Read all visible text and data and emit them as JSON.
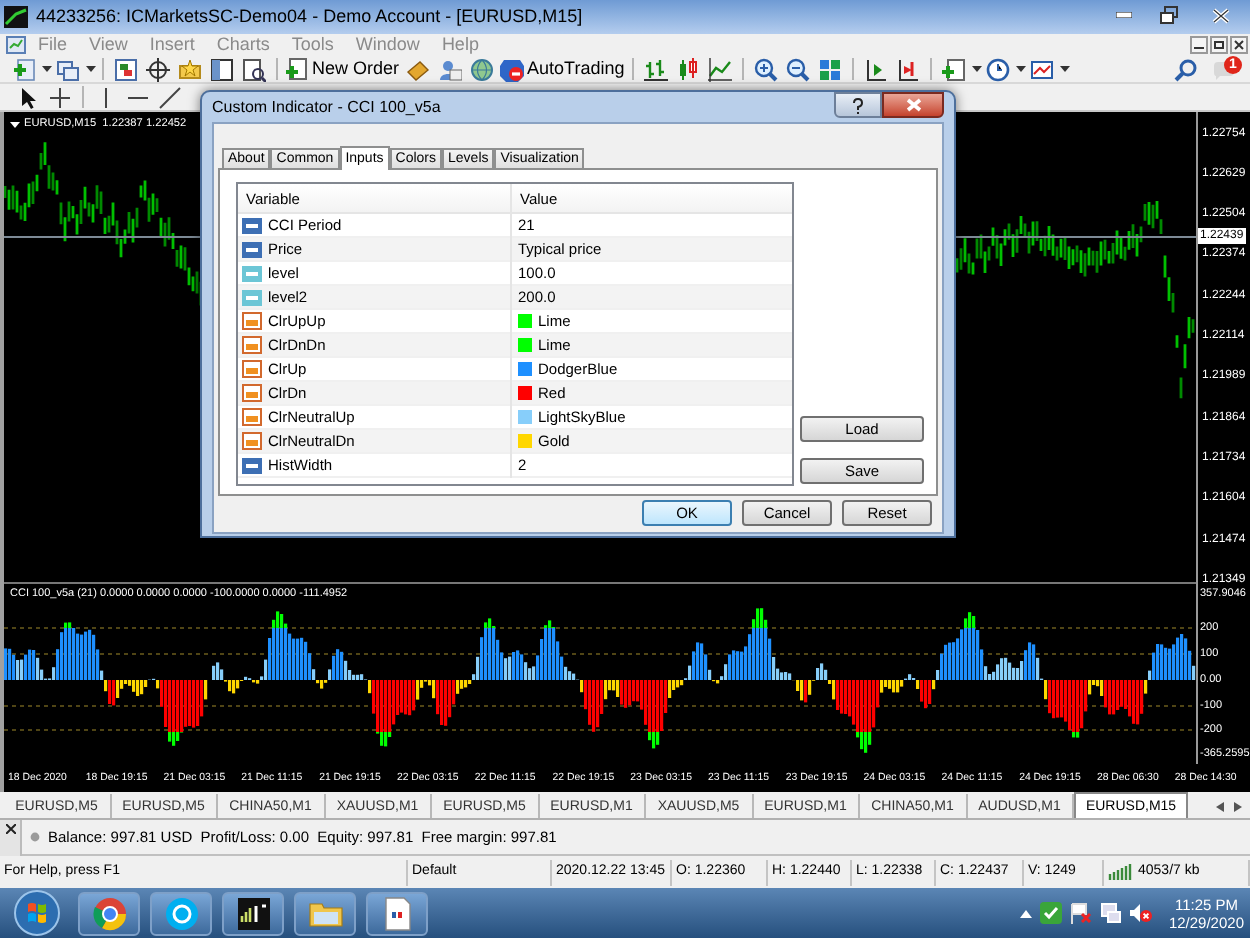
{
  "window": {
    "title": "44233256: ICMarketsSC-Demo04 - Demo Account - [EURUSD,M15]"
  },
  "menu": [
    "File",
    "View",
    "Insert",
    "Charts",
    "Tools",
    "Window",
    "Help"
  ],
  "toolbar": {
    "new_order": "New Order",
    "autotrading": "AutoTrading",
    "notifications": "1"
  },
  "chart": {
    "caption": "EURUSD,M15  1.22387 1.22452",
    "price_axis": [
      "1.22754",
      "1.22629",
      "1.22504",
      "1.22374",
      "1.22244",
      "1.22114",
      "1.21989",
      "1.21864",
      "1.21734",
      "1.21604",
      "1.21474",
      "1.21349"
    ],
    "current_price": "1.22439",
    "indicator_caption": "CCI 100_v5a (21) 0.0000 0.0000 0.0000 -100.0000 0.0000 -111.4952",
    "indicator_axis": [
      "357.9046",
      "200",
      "100",
      "0.00",
      "-100",
      "-200",
      "-365.2595"
    ],
    "time_axis": [
      "18 Dec 2020",
      "18 Dec 19:15",
      "21 Dec 03:15",
      "21 Dec 11:15",
      "21 Dec 19:15",
      "22 Dec 03:15",
      "22 Dec 11:15",
      "22 Dec 19:15",
      "23 Dec 03:15",
      "23 Dec 11:15",
      "23 Dec 19:15",
      "24 Dec 03:15",
      "24 Dec 11:15",
      "24 Dec 19:15",
      "28 Dec 06:30",
      "28 Dec 14:30"
    ]
  },
  "chart_tabs": [
    {
      "label": "EURUSD,M5",
      "selected": false
    },
    {
      "label": "EURUSD,M5",
      "selected": false
    },
    {
      "label": "CHINA50,M1",
      "selected": false
    },
    {
      "label": "XAUUSD,M1",
      "selected": false
    },
    {
      "label": "EURUSD,M5",
      "selected": false
    },
    {
      "label": "EURUSD,M1",
      "selected": false
    },
    {
      "label": "XAUUSD,M5",
      "selected": false
    },
    {
      "label": "EURUSD,M1",
      "selected": false
    },
    {
      "label": "CHINA50,M1",
      "selected": false
    },
    {
      "label": "AUDUSD,M1",
      "selected": false
    },
    {
      "label": "EURUSD,M15",
      "selected": true
    }
  ],
  "terminal": {
    "balance": "Balance: 997.81 USD  Profit/Loss: 0.00  Equity: 997.81  Free margin: 997.81"
  },
  "status_bar": [
    "For Help, press F1",
    "Default",
    "2020.12.22 13:45",
    "O: 1.22360",
    "H: 1.22440",
    "L: 1.22338",
    "C: 1.22437",
    "V: 1249",
    "4053/7 kb"
  ],
  "dialog": {
    "title": "Custom Indicator - CCI 100_v5a",
    "tabs": [
      {
        "label": "About",
        "selected": false
      },
      {
        "label": "Common",
        "selected": false
      },
      {
        "label": "Inputs",
        "selected": true
      },
      {
        "label": "Colors",
        "selected": false
      },
      {
        "label": "Levels",
        "selected": false
      },
      {
        "label": "Visualization",
        "selected": false
      }
    ],
    "columns": [
      "Variable",
      "Value"
    ],
    "rows": [
      {
        "kind": "int",
        "variable": "CCI Period",
        "value": "21"
      },
      {
        "kind": "int",
        "variable": "Price",
        "value": "Typical price"
      },
      {
        "kind": "double",
        "variable": "level",
        "value": "100.0"
      },
      {
        "kind": "double",
        "variable": "level2",
        "value": "200.0"
      },
      {
        "kind": "color",
        "variable": "ClrUpUp",
        "value": "Lime",
        "color": "#00ff00"
      },
      {
        "kind": "color",
        "variable": "ClrDnDn",
        "value": "Lime",
        "color": "#00ff00"
      },
      {
        "kind": "color",
        "variable": "ClrUp",
        "value": "DodgerBlue",
        "color": "#1e90ff"
      },
      {
        "kind": "color",
        "variable": "ClrDn",
        "value": "Red",
        "color": "#ff0000"
      },
      {
        "kind": "color",
        "variable": "ClrNeutralUp",
        "value": "LightSkyBlue",
        "color": "#87cefa"
      },
      {
        "kind": "color",
        "variable": "ClrNeutralDn",
        "value": "Gold",
        "color": "#ffd700"
      },
      {
        "kind": "int",
        "variable": "HistWidth",
        "value": "2"
      }
    ],
    "side_buttons": [
      "Load",
      "Save"
    ],
    "buttons": [
      {
        "label": "OK",
        "default": true
      },
      {
        "label": "Cancel",
        "default": false
      },
      {
        "label": "Reset",
        "default": false
      }
    ]
  },
  "taskbar": {
    "time": "11:25 PM",
    "date": "12/29/2020"
  }
}
